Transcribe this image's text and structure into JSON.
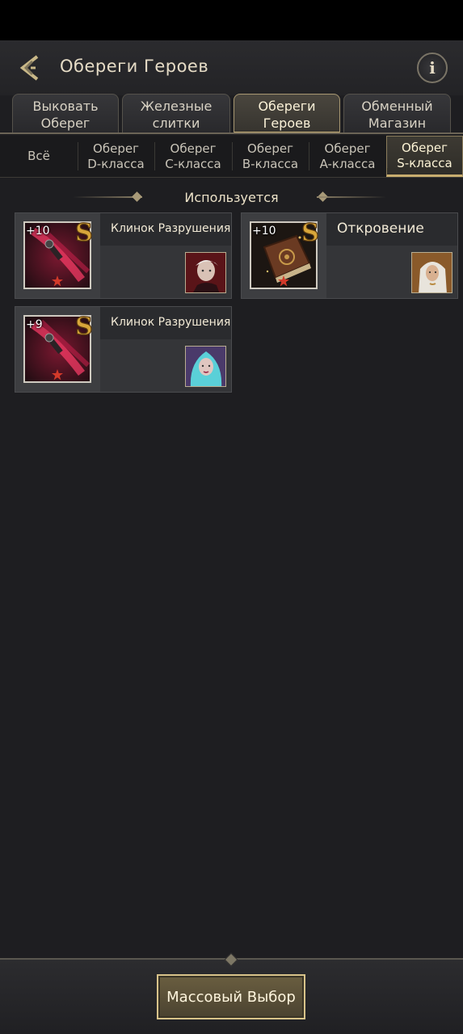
{
  "header": {
    "title": "Обереги Героев",
    "info_label": "i"
  },
  "tabs": [
    {
      "label": "Выковать\nОберег",
      "active": false
    },
    {
      "label": "Железные\nслитки",
      "active": false
    },
    {
      "label": "Обереги\nГероев",
      "active": true
    },
    {
      "label": "Обменный\nМагазин",
      "active": false
    }
  ],
  "subtabs": [
    {
      "label": "Всё",
      "active": false
    },
    {
      "label": "Оберег\nD-класса",
      "active": false
    },
    {
      "label": "Оберег\nC-класса",
      "active": false
    },
    {
      "label": "Оберег\nB-класса",
      "active": false
    },
    {
      "label": "Оберег\nA-класса",
      "active": false
    },
    {
      "label": "Оберег\nS-класса",
      "active": true
    }
  ],
  "section": {
    "title": "Используется"
  },
  "cards": [
    {
      "name": "Клинок Разрушения",
      "level": "+10",
      "grade": "S",
      "item_icon": "blade-icon",
      "hero": "white-haired-hero-portrait"
    },
    {
      "name": "Откровение",
      "level": "+10",
      "grade": "S",
      "item_icon": "book-icon",
      "hero": "veiled-heroine-portrait"
    },
    {
      "name": "Клинок Разрушения",
      "level": "+9",
      "grade": "S",
      "item_icon": "blade-icon",
      "hero": "teal-haired-heroine-portrait"
    }
  ],
  "footer": {
    "mass_select_label": "Массовый Выбор"
  },
  "colors": {
    "accent_gold": "#c9b27a",
    "background": "#1e1e21",
    "card": "#343538"
  }
}
